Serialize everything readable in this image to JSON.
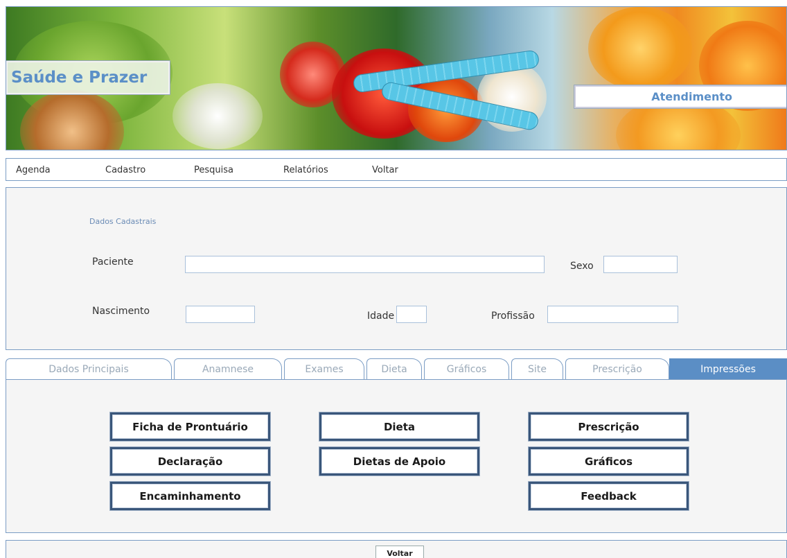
{
  "header": {
    "brand": "Saúde e Prazer",
    "section_title": "Atendimento"
  },
  "menu": {
    "items": [
      "Agenda",
      "Cadastro",
      "Pesquisa",
      "Relatórios",
      "Voltar"
    ]
  },
  "dados_cadastrais": {
    "caption": "Dados Cadastrais",
    "paciente_label": "Paciente",
    "paciente_value": "",
    "sexo_label": "Sexo",
    "sexo_value": "",
    "nascimento_label": "Nascimento",
    "nascimento_value": "",
    "idade_label": "Idade",
    "idade_value": "",
    "profissao_label": "Profissão",
    "profissao_value": ""
  },
  "tabs": {
    "items": [
      "Dados Principais",
      "Anamnese",
      "Exames",
      "Dieta",
      "Gráficos",
      "Site",
      "Prescrição",
      "Impressões"
    ],
    "active": "Impressões"
  },
  "impressoes": {
    "buttons": [
      "Ficha de Prontuário",
      "Dieta",
      "Prescrição",
      "Declaração",
      "Dietas de Apoio",
      "Gráficos",
      "Encaminhamento",
      "Feedback"
    ]
  },
  "footer": {
    "voltar_label": "Voltar"
  },
  "colors": {
    "accent": "#5b8ec5",
    "border": "#7a9cc4",
    "brand_text": "#5b8fc7",
    "button_border": "#3a567a"
  }
}
